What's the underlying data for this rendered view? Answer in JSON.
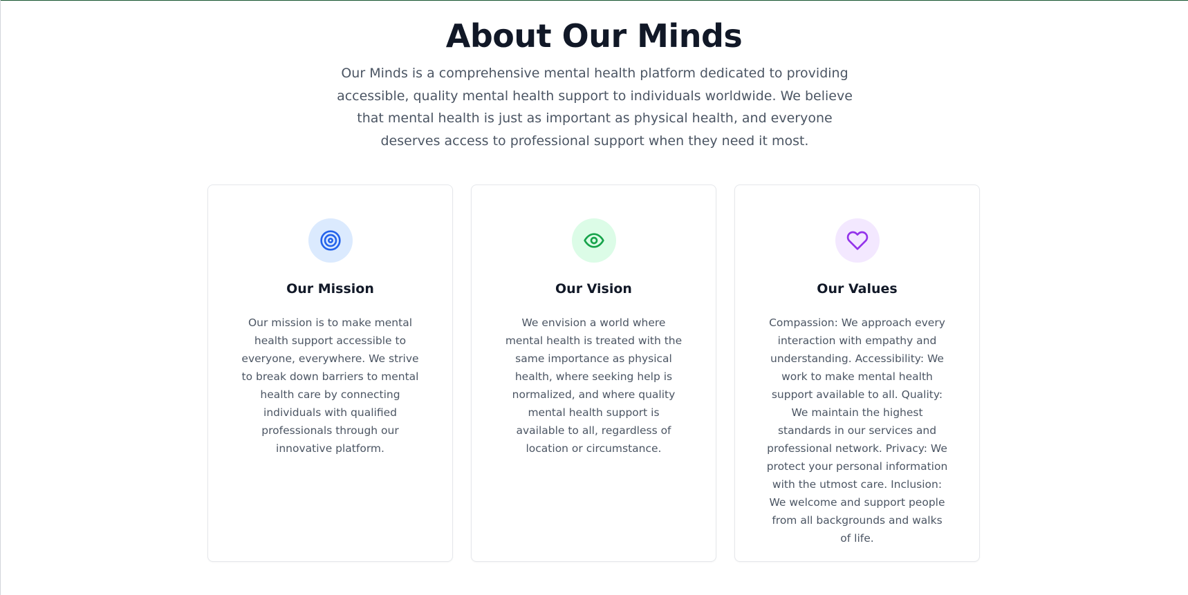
{
  "page": {
    "title": "About Our Minds",
    "intro": "Our Minds is a comprehensive mental health platform dedicated to providing accessible, quality mental health support to individuals worldwide. We believe that mental health is just as important as physical health, and everyone deserves access to professional support when they need it most."
  },
  "cards": [
    {
      "icon": "target-icon",
      "icon_color": "#2563eb",
      "icon_bg": "#dbeafe",
      "title": "Our Mission",
      "text": "Our mission is to make mental health support accessible to everyone, everywhere. We strive to break down barriers to mental health care by connecting individuals with qualified professionals through our innovative platform."
    },
    {
      "icon": "eye-icon",
      "icon_color": "#16a34a",
      "icon_bg": "#dcfce7",
      "title": "Our Vision",
      "text": "We envision a world where mental health is treated with the same importance as physical health, where seeking help is normalized, and where quality mental health support is available to all, regardless of location or circumstance."
    },
    {
      "icon": "heart-icon",
      "icon_color": "#9333ea",
      "icon_bg": "#f3e8ff",
      "title": "Our Values",
      "text": "Compassion: We approach every interaction with empathy and understanding. Accessibility: We work to make mental health support available to all. Quality: We maintain the highest standards in our services and professional network. Privacy: We protect your personal information with the utmost care. Inclusion: We welcome and support people from all backgrounds and walks of life."
    }
  ]
}
